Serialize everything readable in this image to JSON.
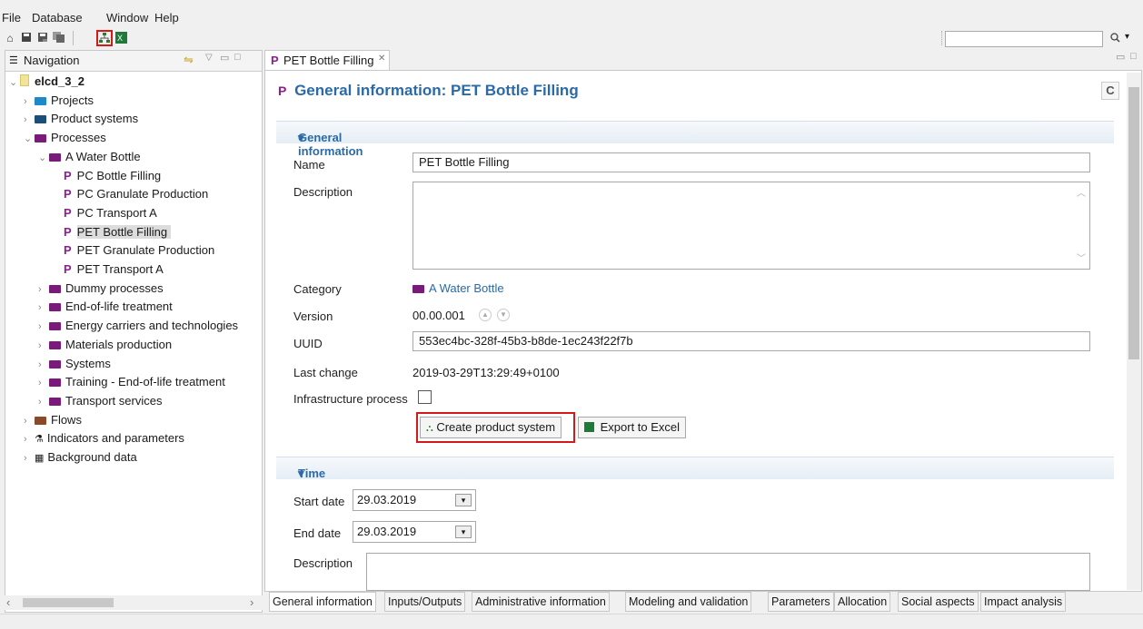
{
  "menu": [
    "File",
    "Database",
    "Window",
    "Help"
  ],
  "toolbar": {
    "icons": [
      "home-icon",
      "save-icon",
      "save-as-icon",
      "save-all-icon",
      "create-product-system-icon",
      "excel-icon"
    ],
    "search_placeholder": "",
    "search_icon": "🔍"
  },
  "nav": {
    "title": "Navigation",
    "tree": [
      {
        "label": "elcd_3_2",
        "indent": 0,
        "arrow": "⌄",
        "kind": "db"
      },
      {
        "label": "Projects",
        "indent": 1,
        "arrow": "›",
        "kind": "folder",
        "color": "#1e88c8"
      },
      {
        "label": "Product systems",
        "indent": 1,
        "arrow": "›",
        "kind": "folder",
        "color": "#1a4f7a"
      },
      {
        "label": "Processes",
        "indent": 1,
        "arrow": "⌄",
        "kind": "folder",
        "color": "#7a1a7a"
      },
      {
        "label": "A Water Bottle",
        "indent": 2,
        "arrow": "⌄",
        "kind": "folder",
        "color": "#7a1a7a"
      },
      {
        "label": "PC Bottle Filling",
        "indent": 3,
        "arrow": "",
        "kind": "process"
      },
      {
        "label": "PC Granulate Production",
        "indent": 3,
        "arrow": "",
        "kind": "process"
      },
      {
        "label": "PC Transport A",
        "indent": 3,
        "arrow": "",
        "kind": "process"
      },
      {
        "label": "PET Bottle Filling",
        "indent": 3,
        "arrow": "",
        "kind": "process",
        "selected": true
      },
      {
        "label": "PET Granulate Production",
        "indent": 3,
        "arrow": "",
        "kind": "process"
      },
      {
        "label": "PET Transport A",
        "indent": 3,
        "arrow": "",
        "kind": "process"
      },
      {
        "label": "Dummy processes",
        "indent": 2,
        "arrow": "›",
        "kind": "folder",
        "color": "#7a1a7a"
      },
      {
        "label": "End-of-life treatment",
        "indent": 2,
        "arrow": "›",
        "kind": "folder",
        "color": "#7a1a7a"
      },
      {
        "label": "Energy carriers and technologies",
        "indent": 2,
        "arrow": "›",
        "kind": "folder",
        "color": "#7a1a7a"
      },
      {
        "label": "Materials production",
        "indent": 2,
        "arrow": "›",
        "kind": "folder",
        "color": "#7a1a7a"
      },
      {
        "label": "Systems",
        "indent": 2,
        "arrow": "›",
        "kind": "folder",
        "color": "#7a1a7a"
      },
      {
        "label": "Training - End-of-life treatment",
        "indent": 2,
        "arrow": "›",
        "kind": "folder",
        "color": "#7a1a7a"
      },
      {
        "label": "Transport services",
        "indent": 2,
        "arrow": "›",
        "kind": "folder",
        "color": "#7a1a7a"
      },
      {
        "label": "Flows",
        "indent": 1,
        "arrow": "›",
        "kind": "folder",
        "color": "#8a4a2a"
      },
      {
        "label": "Indicators and parameters",
        "indent": 1,
        "arrow": "›",
        "kind": "indicator"
      },
      {
        "label": "Background data",
        "indent": 1,
        "arrow": "›",
        "kind": "grid"
      }
    ]
  },
  "editor": {
    "tab_label": "PET Bottle Filling",
    "form_title": "General information: PET Bottle Filling",
    "general": {
      "section_title": "General information",
      "name_label": "Name",
      "name_value": "PET Bottle Filling",
      "description_label": "Description",
      "description_value": "",
      "category_label": "Category",
      "category_value": "A Water Bottle",
      "version_label": "Version",
      "version_value": "00.00.001",
      "uuid_label": "UUID",
      "uuid_value": "553ec4bc-328f-45b3-b8de-1ec243f22f7b",
      "last_change_label": "Last change",
      "last_change_value": "2019-03-29T13:29:49+0100",
      "infrastructure_label": "Infrastructure process",
      "infrastructure_checked": false,
      "create_ps_button": "Create product system",
      "export_excel_button": "Export to Excel"
    },
    "time": {
      "section_title": "Time",
      "start_label": "Start date",
      "start_value": "29.03.2019",
      "end_label": "End date",
      "end_value": "29.03.2019",
      "description_label": "Description"
    }
  },
  "bottom_tabs": [
    "General information",
    "Inputs/Outputs",
    "Administrative information",
    "Modeling and validation",
    "Parameters",
    "Allocation",
    "Social aspects",
    "Impact analysis"
  ],
  "colors": {
    "accent": "#2a6aa8",
    "highlight_box": "#d21a1a",
    "process_glyph": "#8b1f8b"
  }
}
